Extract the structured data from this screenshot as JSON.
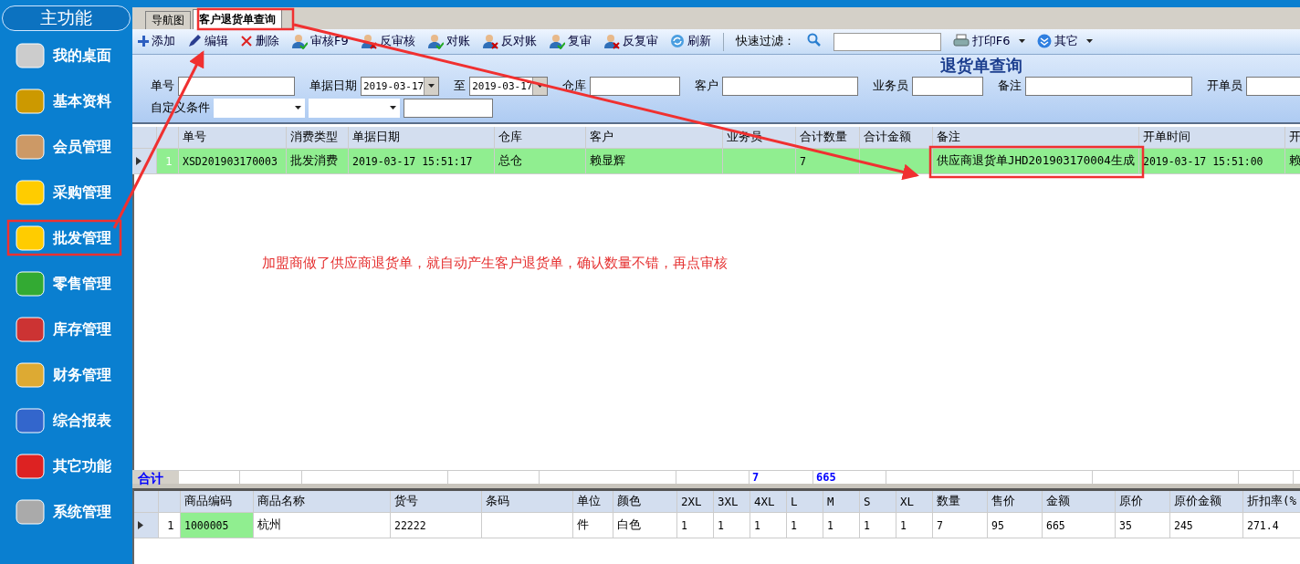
{
  "sidebar": {
    "title": "主功能",
    "items": [
      {
        "label": "我的桌面"
      },
      {
        "label": "基本资料"
      },
      {
        "label": "会员管理"
      },
      {
        "label": "采购管理"
      },
      {
        "label": "批发管理"
      },
      {
        "label": "零售管理"
      },
      {
        "label": "库存管理"
      },
      {
        "label": "财务管理"
      },
      {
        "label": "综合报表"
      },
      {
        "label": "其它功能"
      },
      {
        "label": "系统管理"
      }
    ]
  },
  "tabs": [
    {
      "label": "导航图",
      "selected": false
    },
    {
      "label": "客户退货单查询",
      "selected": true
    }
  ],
  "toolbar": {
    "buttons": [
      "添加",
      "编辑",
      "删除",
      "审核F9",
      "反审核",
      "对账",
      "反对账",
      "复审",
      "反复审",
      "刷新"
    ],
    "filter_label": "快速过滤：",
    "menus": [
      "打印F6",
      "其它"
    ]
  },
  "query": {
    "title": "退货单查询",
    "fields": [
      {
        "label": "单号",
        "kind": "text"
      },
      {
        "label": "单据日期",
        "kind": "date",
        "value": "2019-03-17"
      },
      {
        "label": "至",
        "kind": "date",
        "value": "2019-03-17"
      },
      {
        "label": "仓库",
        "kind": "text"
      },
      {
        "label": "客户",
        "kind": "text"
      },
      {
        "label": "业务员",
        "kind": "text"
      },
      {
        "label": "备注",
        "kind": "text"
      },
      {
        "label": "开单员",
        "kind": "text"
      }
    ],
    "custom_label": "自定义条件"
  },
  "main_grid": {
    "columns": [
      "单号",
      "消费类型",
      "单据日期",
      "仓库",
      "客户",
      "业务员",
      "合计数量",
      "合计金额",
      "备注",
      "开单时间",
      "开"
    ],
    "rows": [
      {
        "number": "1",
        "selected": true,
        "cells": [
          "XSD201903170003",
          "批发消费",
          "2019-03-17 15:51:17",
          "总仓",
          "赖显辉",
          null,
          "7",
          null,
          "供应商退货单JHD201903170004生成",
          "2019-03-17 15:51:00",
          "赖"
        ]
      }
    ],
    "totals": {
      "label": "合计",
      "quantity": "7",
      "amount": "665"
    }
  },
  "note": "加盟商做了供应商退货单，就自动产生客户退货单，确认数量不错，再点审核",
  "detail_grid": {
    "columns": [
      "商品编码",
      "商品名称",
      "货号",
      "条码",
      "单位",
      "颜色",
      "2XL",
      "3XL",
      "4XL",
      "L",
      "M",
      "S",
      "XL",
      "数量",
      "售价",
      "金额",
      "原价",
      "原价金额",
      "折扣率(%"
    ],
    "rows": [
      {
        "number": "1",
        "selected": true,
        "cells": [
          "1000005",
          "杭州",
          "22222",
          null,
          "件",
          "白色",
          "1",
          "1",
          "1",
          "1",
          "1",
          "1",
          "1",
          "7",
          "95",
          "665",
          "35",
          "245",
          "271.4"
        ]
      }
    ]
  }
}
